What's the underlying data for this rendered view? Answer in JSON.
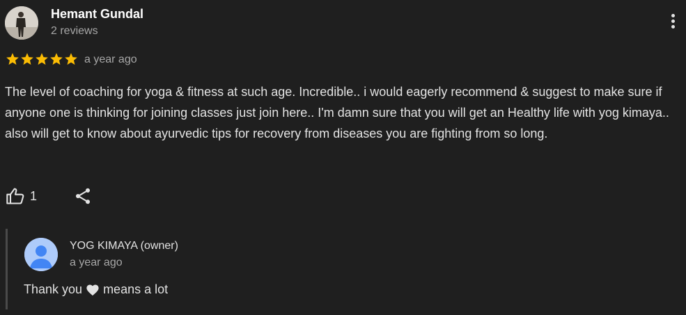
{
  "review": {
    "author": "Hemant Gundal",
    "author_sub": "2 reviews",
    "rating": 5,
    "rating_max": 5,
    "time": "a year ago",
    "text": "The level of coaching for yoga & fitness at such age. Incredible.. i would eagerly recommend & suggest to make sure if anyone one is thinking for joining classes just join here.. I'm damn sure that you will get an Healthy life with yog kimaya.. also will get to know about ayurvedic tips for recovery from diseases you are fighting from so long.",
    "like_count": "1"
  },
  "reply": {
    "author": "YOG KIMAYA (owner)",
    "time": "a year ago",
    "text_before": "Thank you",
    "text_after": "means a lot"
  },
  "colors": {
    "background": "#1f1f1f",
    "star": "#fbbc04",
    "owner_avatar": "#aecbfa",
    "owner_avatar_figure": "#4285f4"
  },
  "icons": {
    "menu": "more-vert-icon",
    "like": "thumb-up-icon",
    "share": "share-icon",
    "star": "star-icon",
    "heart": "heart-icon"
  }
}
